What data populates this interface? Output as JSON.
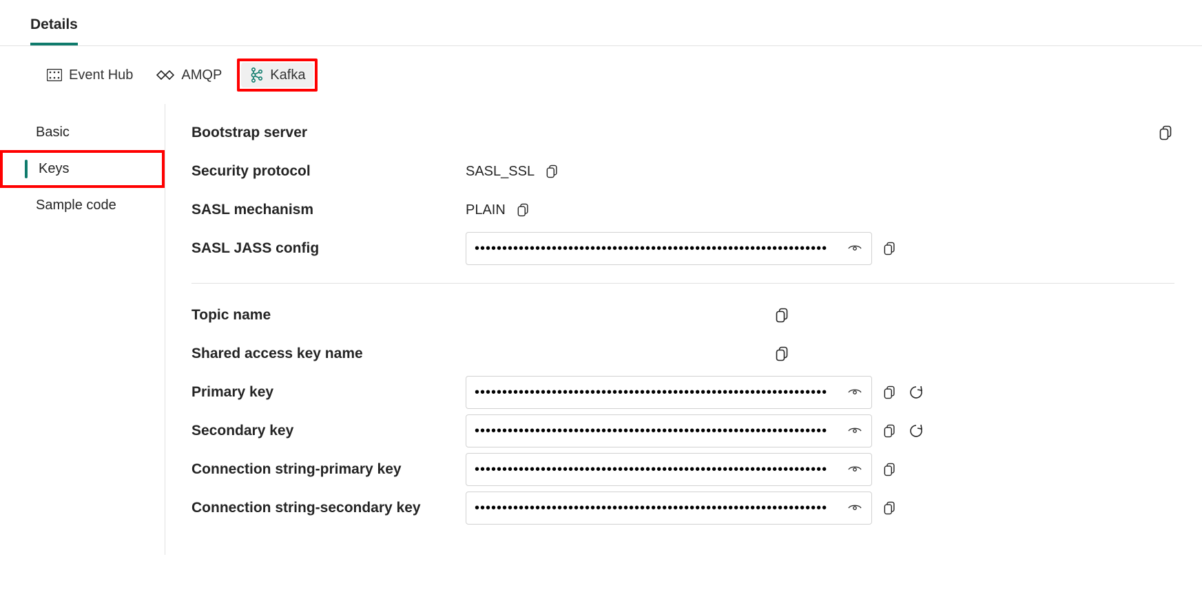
{
  "top_tab": {
    "label": "Details"
  },
  "protocol_tabs": [
    {
      "key": "eventhub",
      "label": "Event Hub",
      "active": false
    },
    {
      "key": "amqp",
      "label": "AMQP",
      "active": false
    },
    {
      "key": "kafka",
      "label": "Kafka",
      "active": true
    }
  ],
  "sidebar": {
    "items": [
      {
        "key": "basic",
        "label": "Basic",
        "active": false
      },
      {
        "key": "keys",
        "label": "Keys",
        "active": true
      },
      {
        "key": "sample",
        "label": "Sample code",
        "active": false
      }
    ]
  },
  "fields": {
    "bootstrap_server": {
      "label": "Bootstrap server",
      "value": ""
    },
    "security_protocol": {
      "label": "Security protocol",
      "value": "SASL_SSL"
    },
    "sasl_mechanism": {
      "label": "SASL mechanism",
      "value": "PLAIN"
    },
    "sasl_jass_config": {
      "label": "SASL JASS config",
      "masked": "••••••••••••••••••••••••••••••••••••••••••••••••••••••••••••••••"
    },
    "topic_name": {
      "label": "Topic name",
      "value": ""
    },
    "shared_access_key_name": {
      "label": "Shared access key name",
      "value": ""
    },
    "primary_key": {
      "label": "Primary key",
      "masked": "••••••••••••••••••••••••••••••••••••••••••••••••••••••••••••••••"
    },
    "secondary_key": {
      "label": "Secondary key",
      "masked": "••••••••••••••••••••••••••••••••••••••••••••••••••••••••••••••••"
    },
    "conn_primary": {
      "label": "Connection string-primary key",
      "masked": "••••••••••••••••••••••••••••••••••••••••••••••••••••••••••••••••"
    },
    "conn_secondary": {
      "label": "Connection string-secondary key",
      "masked": "••••••••••••••••••••••••••••••••••••••••••••••••••••••••••••••••"
    }
  }
}
